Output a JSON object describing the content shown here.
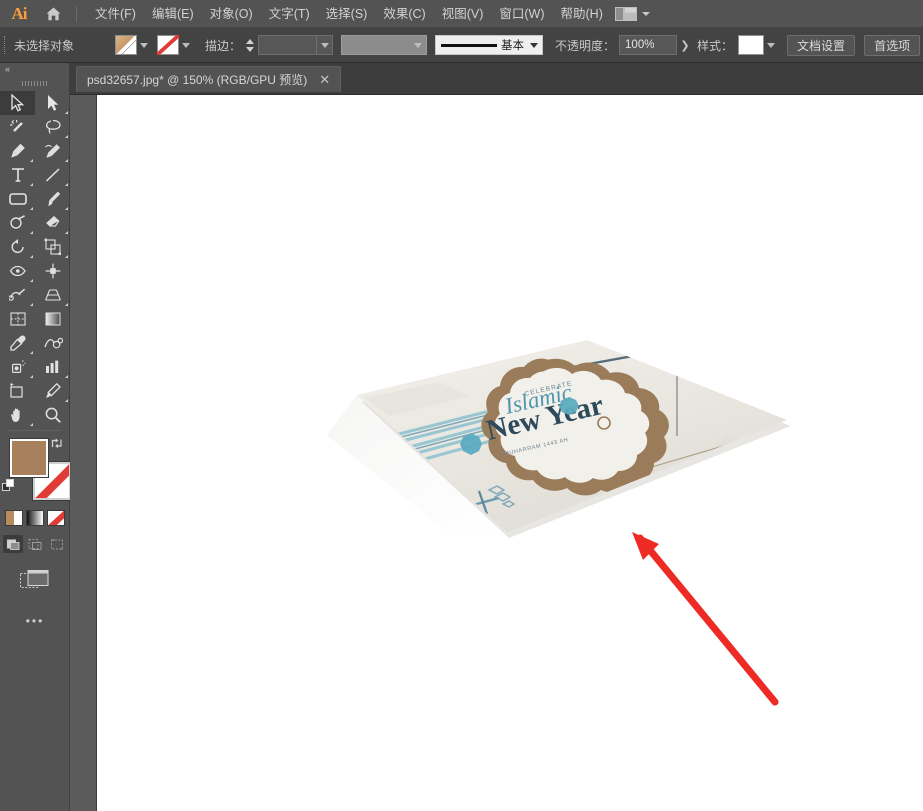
{
  "app": {
    "name": "Adobe Illustrator",
    "logo_text": "Ai"
  },
  "menubar": {
    "home_icon": "home-icon",
    "items": [
      {
        "label": "文件(F)"
      },
      {
        "label": "编辑(E)"
      },
      {
        "label": "对象(O)"
      },
      {
        "label": "文字(T)"
      },
      {
        "label": "选择(S)"
      },
      {
        "label": "效果(C)"
      },
      {
        "label": "视图(V)"
      },
      {
        "label": "窗口(W)"
      },
      {
        "label": "帮助(H)"
      }
    ],
    "workspace_switcher": "workspace-layout-icon"
  },
  "controlbar": {
    "selection_status": "未选择对象",
    "fill_label": "fill-swatch",
    "stroke_swatch_label": "stroke-swatch-none",
    "stroke_label": "描边：",
    "stroke_weight": "",
    "stroke_profile": "",
    "brush_definition": "基本",
    "opacity_label": "不透明度：",
    "opacity_value": "100%",
    "opacity_more": "❯",
    "style_label": "样式：",
    "document_setup": "文档设置",
    "preferences": "首选项"
  },
  "tabbar": {
    "document_title": "psd32657.jpg* @ 150% (RGB/GPU 预览)",
    "close_glyph": "✕"
  },
  "toolpanel": {
    "collapse_glyph": "«",
    "tools": [
      {
        "name": "selection-tool",
        "active": true
      },
      {
        "name": "direct-selection-tool",
        "active": false
      },
      {
        "name": "magic-wand-tool",
        "active": false
      },
      {
        "name": "lasso-tool",
        "active": false
      },
      {
        "name": "pen-tool",
        "active": false
      },
      {
        "name": "curvature-tool",
        "active": false
      },
      {
        "name": "type-tool",
        "active": false
      },
      {
        "name": "line-segment-tool",
        "active": false
      },
      {
        "name": "rectangle-tool",
        "active": false
      },
      {
        "name": "paintbrush-tool",
        "active": false
      },
      {
        "name": "shaper-tool",
        "active": false
      },
      {
        "name": "eraser-tool",
        "active": false
      },
      {
        "name": "rotate-tool",
        "active": false
      },
      {
        "name": "scale-tool",
        "active": false
      },
      {
        "name": "width-tool",
        "active": false
      },
      {
        "name": "free-transform-tool",
        "active": false
      },
      {
        "name": "shape-builder-tool",
        "active": false
      },
      {
        "name": "perspective-grid-tool",
        "active": false
      },
      {
        "name": "mesh-tool",
        "active": false
      },
      {
        "name": "gradient-tool",
        "active": false
      },
      {
        "name": "eyedropper-tool",
        "active": false
      },
      {
        "name": "blend-tool",
        "active": false
      },
      {
        "name": "symbol-sprayer-tool",
        "active": false
      },
      {
        "name": "column-graph-tool",
        "active": false
      },
      {
        "name": "artboard-tool",
        "active": false
      },
      {
        "name": "slice-tool",
        "active": false
      },
      {
        "name": "hand-tool",
        "active": false
      },
      {
        "name": "zoom-tool",
        "active": false
      }
    ],
    "fill_color": "#a9805c",
    "stroke_color": "none",
    "swap_icon": "swap-fill-stroke-icon",
    "default_icon": "default-fill-stroke-icon",
    "color_modes": [
      "color-mode",
      "gradient-mode",
      "none-mode"
    ],
    "drawing_modes": [
      "draw-normal",
      "draw-behind",
      "draw-inside"
    ],
    "screen_mode": "screen-mode-icon",
    "more_tools": "•••"
  },
  "artwork": {
    "type": "poster-mockup-3d",
    "poster_title_line1": "CELEBRATE",
    "poster_title_line2": "Islamic",
    "poster_title_line3": "New Year",
    "poster_subtitle": "1 MUHARRAM 1443 AH",
    "badge_color": "#9b7c5a",
    "accent_color": "#56a9bd",
    "paper_color": "#eceae4",
    "annotation": {
      "name": "red-arrow-annotation",
      "color": "#ee2a24"
    }
  }
}
